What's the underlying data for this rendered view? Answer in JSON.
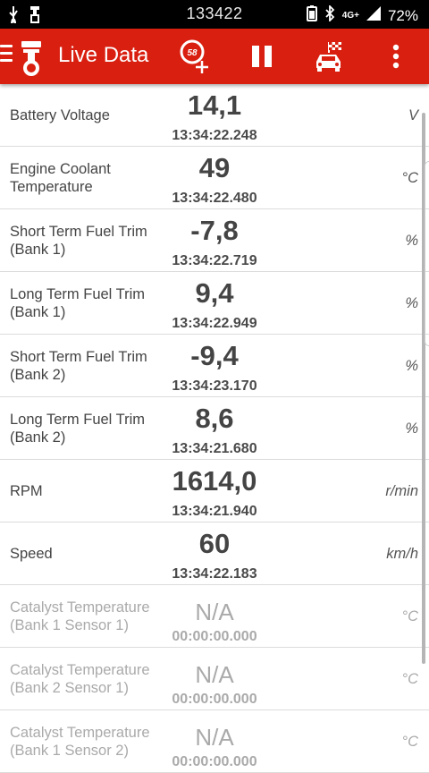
{
  "statusbar": {
    "clock": "133422",
    "network": "4G+",
    "battery": "72%"
  },
  "toolbar": {
    "title": "Live Data",
    "gauge_icon_number": "58",
    "color": "#d81f10"
  },
  "rows": [
    {
      "label": "Battery Voltage",
      "value": "14,1",
      "time": "13:34:22.248",
      "unit": "V"
    },
    {
      "label": "Engine Coolant Temperature",
      "value": "49",
      "time": "13:34:22.480",
      "unit": "°C"
    },
    {
      "label": "Short Term Fuel Trim (Bank 1)",
      "value": "-7,8",
      "time": "13:34:22.719",
      "unit": "%"
    },
    {
      "label": "Long Term Fuel Trim (Bank 1)",
      "value": "9,4",
      "time": "13:34:22.949",
      "unit": "%"
    },
    {
      "label": "Short Term Fuel Trim (Bank 2)",
      "value": "-9,4",
      "time": "13:34:23.170",
      "unit": "%"
    },
    {
      "label": "Long Term Fuel Trim (Bank 2)",
      "value": "8,6",
      "time": "13:34:21.680",
      "unit": "%"
    },
    {
      "label": "RPM",
      "value": "1614,0",
      "time": "13:34:21.940",
      "unit": "r/min"
    },
    {
      "label": "Speed",
      "value": "60",
      "time": "13:34:22.183",
      "unit": "km/h"
    },
    {
      "label": "Catalyst Temperature (Bank 1 Sensor 1)",
      "value": "N/A",
      "time": "00:00:00.000",
      "unit": "°C"
    },
    {
      "label": "Catalyst Temperature (Bank 2 Sensor 1)",
      "value": "N/A",
      "time": "00:00:00.000",
      "unit": "°C"
    },
    {
      "label": "Catalyst Temperature (Bank 1 Sensor 2)",
      "value": "N/A",
      "time": "00:00:00.000",
      "unit": "°C"
    }
  ]
}
